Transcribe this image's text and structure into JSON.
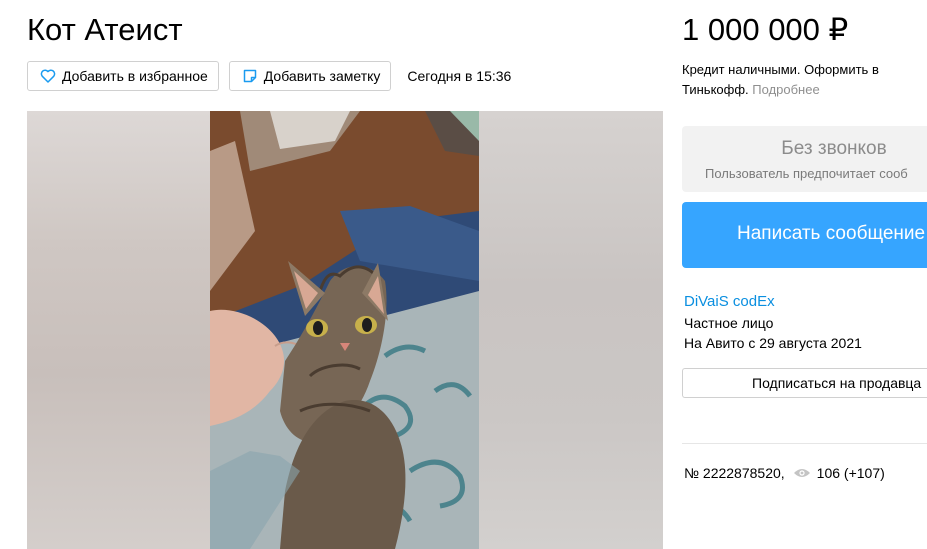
{
  "listing": {
    "title": "Кот Атеист",
    "price": "1 000 000 ₽",
    "date": "Сегодня в 15:36",
    "number": "№ 2222878520,",
    "views": "106 (+107)"
  },
  "actions": {
    "favorite_label": "Добавить в избранное",
    "note_label": "Добавить заметку"
  },
  "credit": {
    "text": "Кредит наличными. Оформить в Тинькофф.",
    "more": "Подробнее"
  },
  "contact": {
    "no_calls_title": "Без звонков",
    "no_calls_sub": "Пользователь предпочитает сооб",
    "write_label": "Написать сообщение"
  },
  "seller": {
    "name": "DiVaiS codEx",
    "type": "Частное лицо",
    "since": "На Авито с 29 августа 2021",
    "subscribe_label": "Подписаться на продавца"
  },
  "icons": {
    "favorite": "heart-icon",
    "note": "note-icon",
    "views": "eye-icon"
  },
  "colors": {
    "accent": "#36a5ff",
    "link": "#0a8fe0",
    "icon": "#1a9bf0"
  }
}
